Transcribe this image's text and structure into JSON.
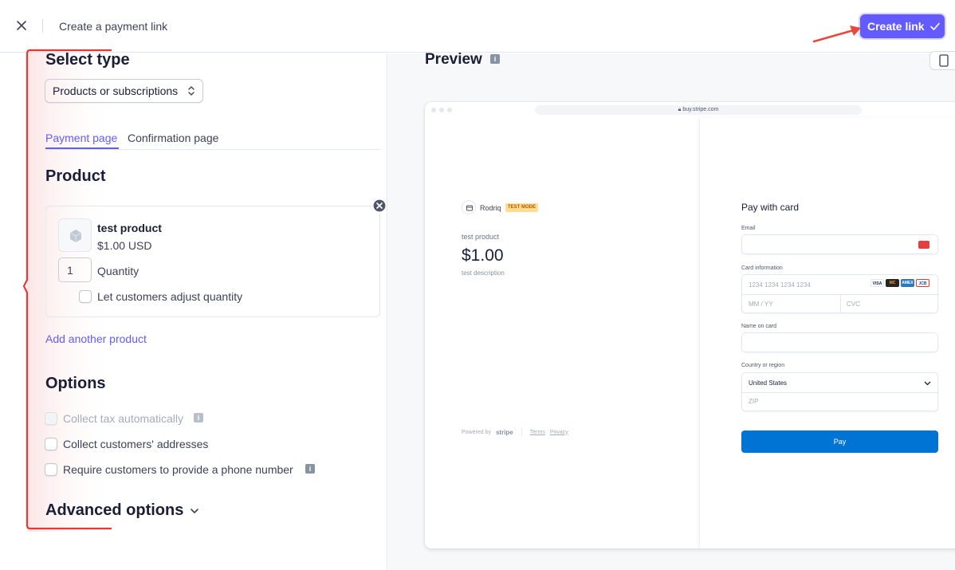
{
  "topbar": {
    "title": "Create a payment link",
    "create_label": "Create link",
    "accent": "#635bff"
  },
  "left": {
    "select_type_heading": "Select type",
    "type_value": "Products or subscriptions",
    "tabs": [
      {
        "label": "Payment page",
        "active": true
      },
      {
        "label": "Confirmation page",
        "active": false
      }
    ],
    "product_heading": "Product",
    "product": {
      "name": "test product",
      "price": "$1.00 USD",
      "quantity": "1",
      "quantity_label": "Quantity",
      "adjust_label": "Let customers adjust quantity"
    },
    "add_product": "Add another product",
    "options_heading": "Options",
    "options": [
      {
        "label": "Collect tax automatically",
        "disabled": true
      },
      {
        "label": "Collect customers' addresses",
        "disabled": false
      },
      {
        "label": "Require customers to provide a phone number",
        "disabled": false
      }
    ],
    "advanced": "Advanced options"
  },
  "preview": {
    "heading": "Preview",
    "url": "buy.stripe.com",
    "merchant": "Rodriq",
    "test_mode": "TEST MODE",
    "product": "test product",
    "price": "$1.00",
    "description": "test description",
    "footer": {
      "powered": "Powered by",
      "brand": "stripe",
      "terms": "Terms",
      "privacy": "Privacy"
    },
    "pay_title": "Pay with card",
    "email_label": "Email",
    "card_label": "Card information",
    "card_placeholder": "1234 1234 1234 1234",
    "expiry_placeholder": "MM / YY",
    "cvc_placeholder": "CVC",
    "name_label": "Name on card",
    "country_label": "Country or region",
    "country_value": "United States",
    "zip_placeholder": "ZIP",
    "pay_button": "Pay",
    "card_brands": [
      "VISA",
      "MC",
      "AMEX",
      "JCB"
    ],
    "pay_color": "#0074d4"
  }
}
